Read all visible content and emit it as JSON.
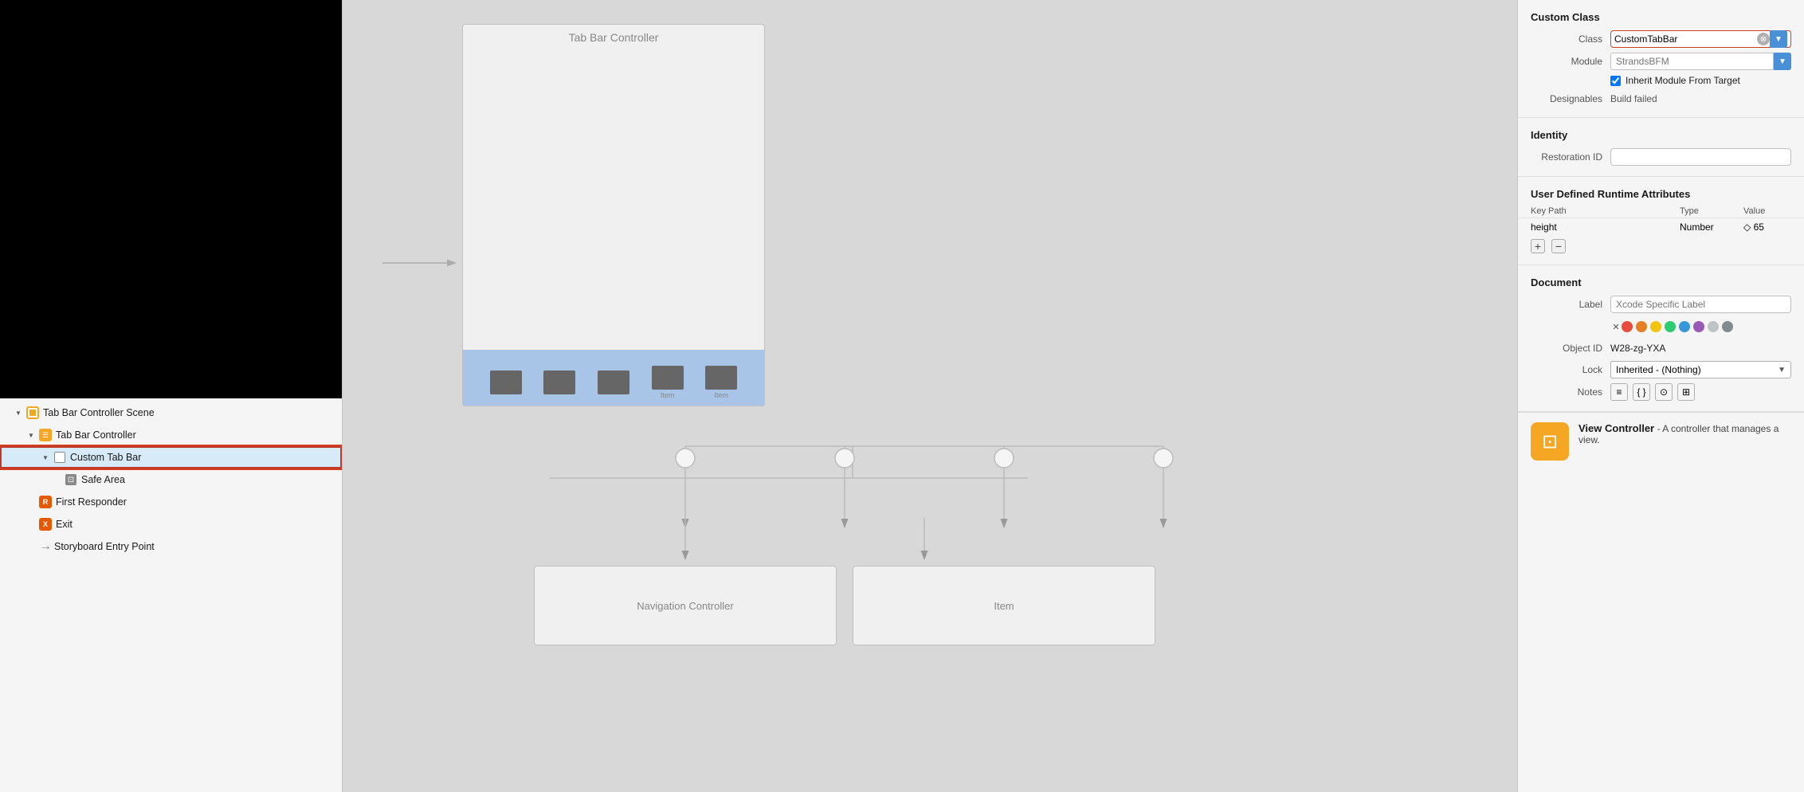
{
  "leftPanel": {
    "canvasPreview": "black",
    "treeItems": [
      {
        "id": "tab-bar-controller-scene",
        "label": "Tab Bar Controller Scene",
        "indent": 1,
        "icon": "scene",
        "disclosure": "open"
      },
      {
        "id": "tab-bar-controller",
        "label": "Tab Bar Controller",
        "indent": 2,
        "icon": "tabbar-ctrl",
        "disclosure": "open"
      },
      {
        "id": "custom-tab-bar",
        "label": "Custom Tab Bar",
        "indent": 3,
        "icon": "view",
        "disclosure": "open",
        "selected": true
      },
      {
        "id": "safe-area",
        "label": "Safe Area",
        "indent": 4,
        "icon": "safe-area",
        "disclosure": "empty"
      },
      {
        "id": "first-responder",
        "label": "First Responder",
        "indent": 2,
        "icon": "first-responder",
        "disclosure": "empty"
      },
      {
        "id": "exit",
        "label": "Exit",
        "indent": 2,
        "icon": "exit",
        "disclosure": "empty"
      },
      {
        "id": "storyboard-entry-point",
        "label": "Storyboard Entry Point",
        "indent": 2,
        "icon": "entry",
        "disclosure": "empty"
      }
    ]
  },
  "canvas": {
    "tabBarControllerLabel": "Tab Bar Controller",
    "navControllerLabel": "Navigation Controller",
    "itemLabel": "Item",
    "tabItems": [
      "",
      "",
      "",
      "Item",
      "Item"
    ]
  },
  "rightPanel": {
    "customClass": {
      "sectionTitle": "Custom Class",
      "classLabel": "Class",
      "classValue": "CustomTabBar",
      "moduleLabel": "Module",
      "modulePlaceholder": "StrandsBFM",
      "inheritLabel": "Inherit Module From Target",
      "designablesLabel": "Designables",
      "designablesValue": "Build failed"
    },
    "identity": {
      "sectionTitle": "Identity",
      "restorationIdLabel": "Restoration ID",
      "restorationIdValue": ""
    },
    "userDefined": {
      "sectionTitle": "User Defined Runtime Attributes",
      "columns": [
        "Key Path",
        "Type",
        "Value"
      ],
      "rows": [
        {
          "keyPath": "height",
          "type": "Number",
          "value": "◇ 65"
        }
      ]
    },
    "document": {
      "sectionTitle": "Document",
      "labelLabel": "Label",
      "labelPlaceholder": "Xcode Specific Label",
      "objectIdLabel": "Object ID",
      "objectIdValue": "W28-zg-YXA",
      "lockLabel": "Lock",
      "lockValue": "Inherited - (Nothing)",
      "notesLabel": "Notes",
      "colors": [
        "#e74c3c",
        "#e67e22",
        "#f1c40f",
        "#2ecc71",
        "#3498db",
        "#9b59b6",
        "#bdc3c7",
        "#7f8c8d"
      ]
    },
    "viewController": {
      "title": "View Controller",
      "description": "- A controller that manages a view."
    }
  }
}
